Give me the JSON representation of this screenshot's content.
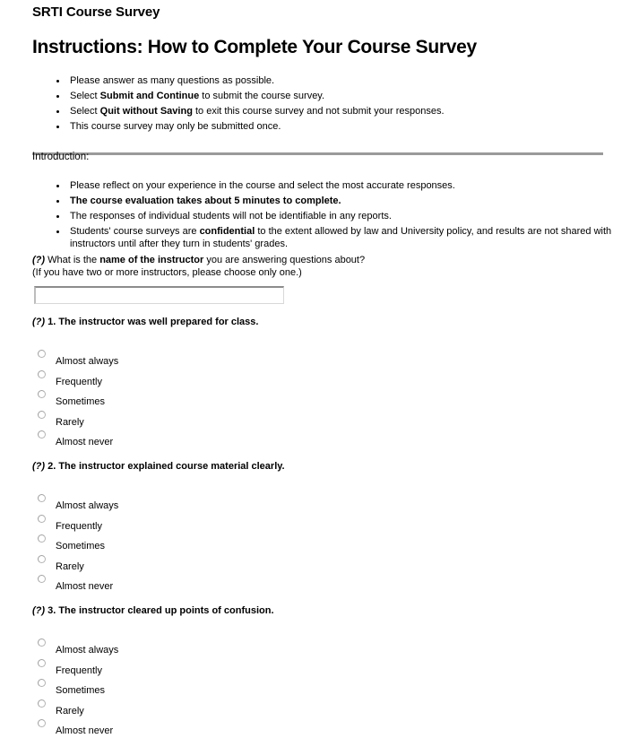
{
  "header": {
    "app_title": "SRTI Course Survey",
    "main_title": "Instructions: How to Complete Your Course Survey"
  },
  "instructions": {
    "items": [
      {
        "pre": "Please answer as many questions as possible.",
        "bold": "",
        "post": ""
      },
      {
        "pre": "Select ",
        "bold": "Submit and Continue",
        "post": " to submit the course survey."
      },
      {
        "pre": "Select ",
        "bold": "Quit without Saving",
        "post": " to exit this course survey and not submit your responses."
      },
      {
        "pre": "This course survey may only be submitted once.",
        "bold": "",
        "post": ""
      }
    ]
  },
  "introduction": {
    "label": "Introduction:",
    "items": [
      {
        "pre": "Please reflect on your experience in the course and select the most accurate responses.",
        "bold": "",
        "post": ""
      },
      {
        "pre": "",
        "bold": "The course evaluation takes about 5 minutes to complete.",
        "post": ""
      },
      {
        "pre": "The responses of individual students will not be identifiable in any reports.",
        "bold": "",
        "post": ""
      },
      {
        "pre": "Students' course surveys are ",
        "bold": "confidential",
        "post": " to the extent allowed by law and University policy, and results are not shared with instructors until after they turn in students' grades."
      }
    ]
  },
  "instructor_question": {
    "marker": "(?)",
    "text_pre": " What is the ",
    "text_bold": "name of the instructor",
    "text_post": " you are answering questions about?",
    "subtext": "(If you have two or more instructors, please choose only one.)",
    "input_value": "",
    "input_placeholder": ""
  },
  "scale_options": [
    "Almost always",
    "Frequently",
    "Sometimes",
    "Rarely",
    "Almost never"
  ],
  "questions": [
    {
      "marker": "(?)",
      "text": " 1. The instructor was well prepared for class."
    },
    {
      "marker": "(?)",
      "text": " 2. The instructor explained course material clearly."
    },
    {
      "marker": "(?)",
      "text": " 3. The instructor cleared up points of confusion."
    }
  ],
  "colors": {
    "divider": "#9a9a9a",
    "text": "#000000",
    "input_border_top": "#8c8c8c",
    "radio_border": "#b5b5b5"
  }
}
